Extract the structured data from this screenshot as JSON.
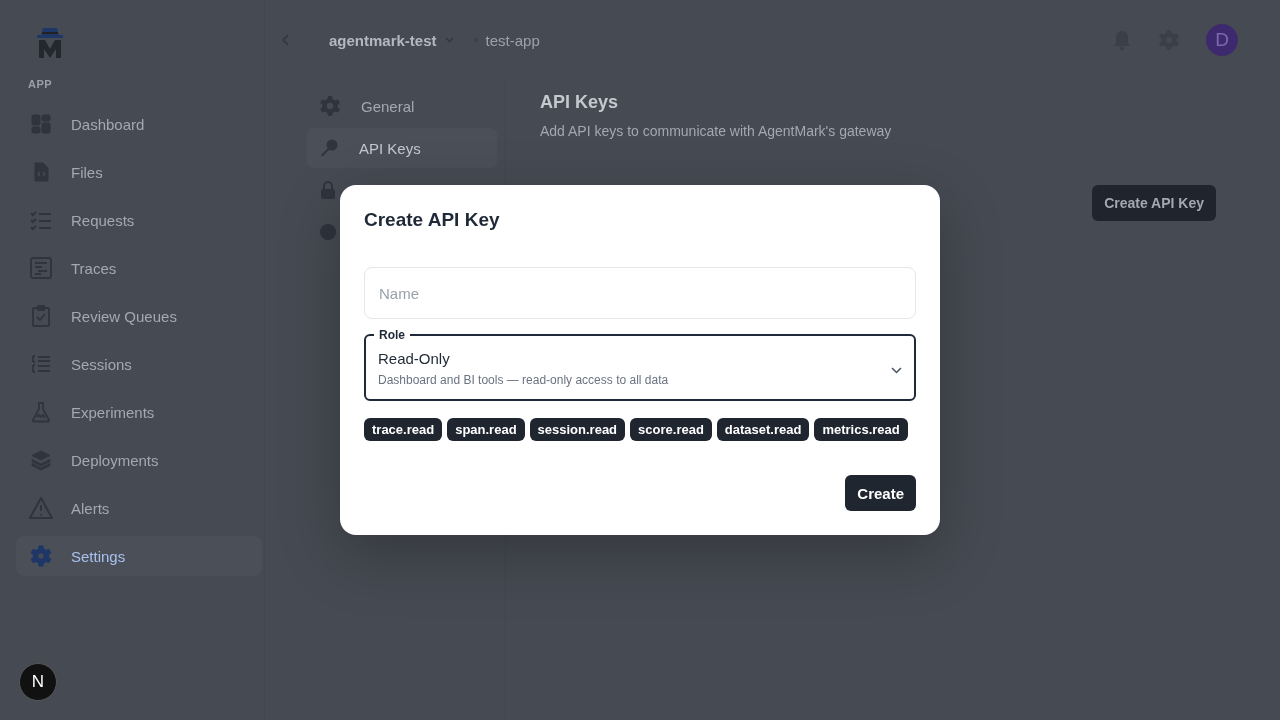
{
  "sidebar": {
    "section_label": "APP",
    "items": [
      {
        "label": "Dashboard",
        "selected": false
      },
      {
        "label": "Files",
        "selected": false
      },
      {
        "label": "Requests",
        "selected": false
      },
      {
        "label": "Traces",
        "selected": false
      },
      {
        "label": "Review Queues",
        "selected": false
      },
      {
        "label": "Sessions",
        "selected": false
      },
      {
        "label": "Experiments",
        "selected": false
      },
      {
        "label": "Deployments",
        "selected": false
      },
      {
        "label": "Alerts",
        "selected": false
      },
      {
        "label": "Settings",
        "selected": true
      }
    ]
  },
  "header": {
    "organization": "agentmark-test",
    "app": "test-app",
    "avatar": "D"
  },
  "settings_nav": [
    {
      "label": "General",
      "selected": false
    },
    {
      "label": "API Keys",
      "selected": true
    }
  ],
  "content": {
    "title": "API Keys",
    "description": "Add API keys to communicate with AgentMark's gateway",
    "button": "Create API Key"
  },
  "dialog": {
    "title": "Create API Key",
    "name_field": {
      "placeholder": "Name"
    },
    "role_field": {
      "label": "Role",
      "value": "Read-Only",
      "description": "Dashboard and BI tools — read-only access to all data"
    },
    "permissions": [
      "trace.read",
      "span.read",
      "session.read",
      "score.read",
      "dataset.read",
      "metrics.read"
    ],
    "button": "Create"
  },
  "dev_badge": "N"
}
